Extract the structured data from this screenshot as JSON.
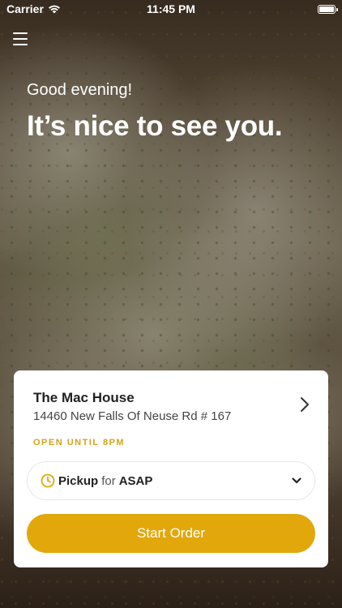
{
  "status_bar": {
    "carrier": "Carrier",
    "time": "11:45 PM",
    "wifi_icon": "wifi-icon",
    "battery_icon": "battery-icon"
  },
  "header": {
    "menu_icon": "hamburger-menu-icon",
    "greeting": "Good evening!",
    "headline": "It’s nice to see you."
  },
  "store": {
    "name": "The Mac House",
    "address": "14460 New Falls Of Neuse Rd # 167",
    "hours": "OPEN UNTIL 8PM",
    "chevron_icon": "chevron-right-icon"
  },
  "order": {
    "mode": "Pickup",
    "for_label": "for",
    "time": "ASAP",
    "clock_icon": "clock-icon",
    "dropdown_icon": "chevron-down-icon",
    "start_label": "Start Order"
  },
  "colors": {
    "accent": "#e2a70b",
    "hours_text": "#d4a21a",
    "card": "#ffffff"
  }
}
